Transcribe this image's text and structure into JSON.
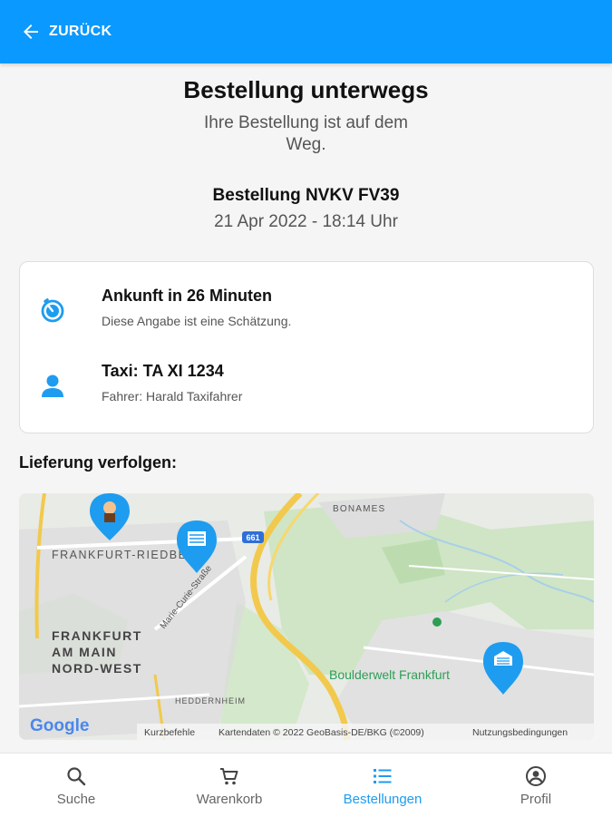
{
  "header": {
    "back_label": "ZURÜCK"
  },
  "status": {
    "title": "Bestellung unterwegs",
    "subtitle": "Ihre Bestellung ist auf dem Weg.",
    "order_number": "Bestellung NVKV FV39",
    "order_date": "21 Apr 2022 - 18:14 Uhr"
  },
  "info": {
    "arrival_title": "Ankunft in 26 Minuten",
    "arrival_note": "Diese Angabe ist eine Schätzung.",
    "taxi_title": "Taxi: TA XI 1234",
    "driver": "Fahrer: Harald Taxifahrer"
  },
  "tracking": {
    "title": "Lieferung verfolgen:",
    "map": {
      "place_riedberg": "FRANKFURT-RIEDBERG",
      "place_nordwest_1": "FRANKFURT",
      "place_nordwest_2": "AM MAIN",
      "place_nordwest_3": "NORD-WEST",
      "place_bonames": "BONAMES",
      "place_heddernheim": "HEDDERNHEIM",
      "poi_boulderwelt": "Boulderwelt Frankfurt",
      "street_curie": "Marie-Curie-Straße",
      "road_shield": "661",
      "google": "Google",
      "shortcuts": "Kurzbefehle",
      "map_data": "Kartendaten © 2022 GeoBasis-DE/BKG (©2009)",
      "terms": "Nutzungsbedingungen"
    }
  },
  "tabs": [
    {
      "label": "Suche",
      "icon": "search-icon"
    },
    {
      "label": "Warenkorb",
      "icon": "cart-icon"
    },
    {
      "label": "Bestellungen",
      "icon": "list-icon",
      "active": true
    },
    {
      "label": "Profil",
      "icon": "profile-icon"
    }
  ],
  "colors": {
    "primary": "#0a99ff",
    "accent": "#1e9cf0"
  }
}
